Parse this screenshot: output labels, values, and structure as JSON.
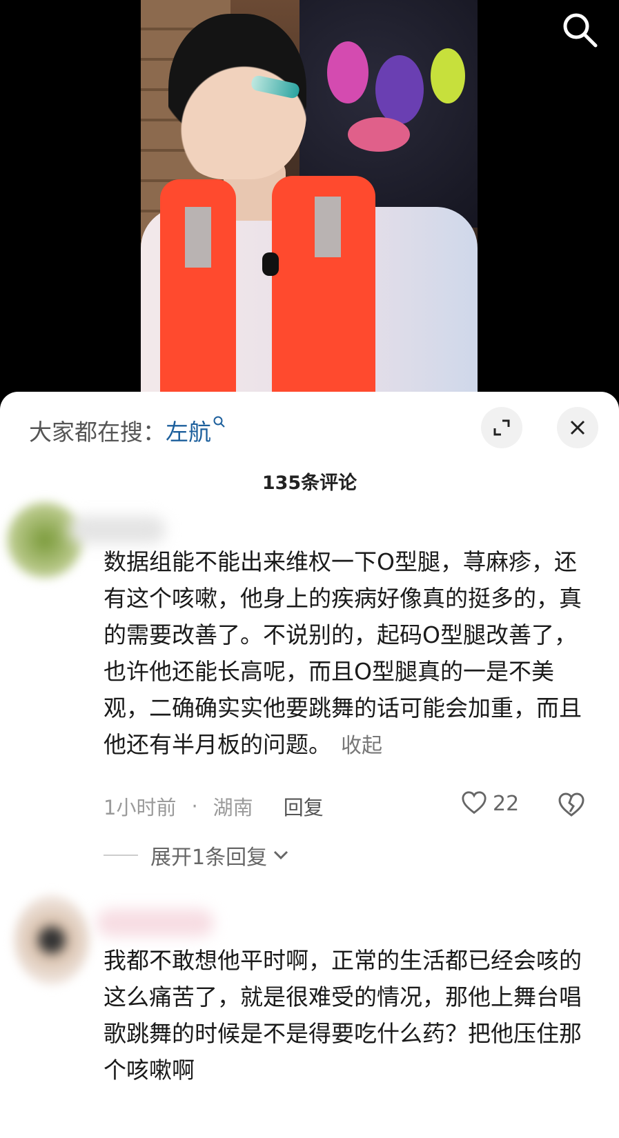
{
  "video": {
    "search_icon": "search-icon"
  },
  "sheet": {
    "search_prefix": "大家都在搜：",
    "search_keyword": "左航",
    "comment_count": "135条评论",
    "expand_icon": "expand-icon",
    "close_icon": "close-icon"
  },
  "comments": [
    {
      "text": "数据组能不能出来维权一下O型腿，荨麻疹，还有这个咳嗽，他身上的疾病好像真的挺多的，真的需要改善了。不说别的，起码O型腿改善了，也许他还能长高呢，而且O型腿真的一是不美观，二确确实实他要跳舞的话可能会加重，而且他还有半月板的问题。",
      "collapse_label": "收起",
      "time": "1小时前",
      "dot": "·",
      "location": "湖南",
      "reply_label": "回复",
      "likes": "22",
      "expand_replies": "展开1条回复"
    },
    {
      "text": "我都不敢想他平时啊，正常的生活都已经会咳的这么痛苦了，就是很难受的情况，那他上舞台唱歌跳舞的时候是不是得要吃什么药？把他压住那个咳嗽啊"
    }
  ]
}
